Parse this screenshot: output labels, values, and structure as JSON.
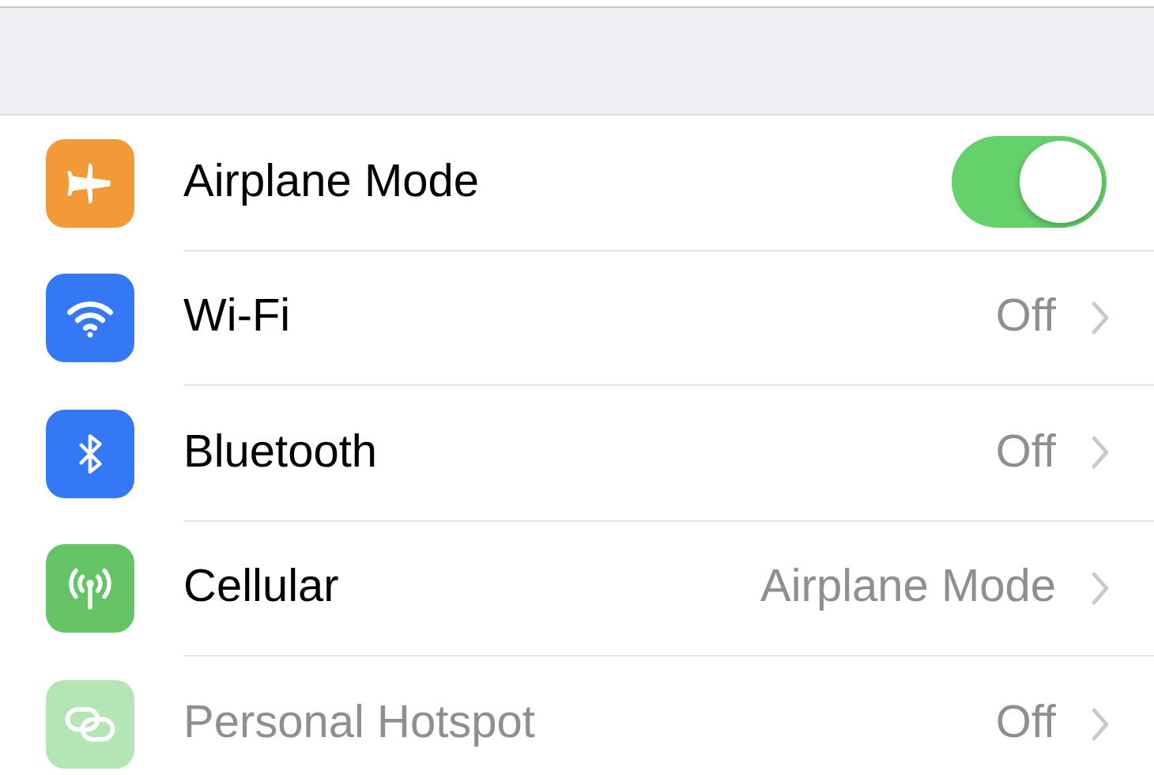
{
  "rows": [
    {
      "kind": "toggle",
      "label": "Airplane Mode",
      "color": "#f19a37",
      "on": true,
      "disabled": false
    },
    {
      "kind": "detail",
      "label": "Wi-Fi",
      "value": "Off",
      "color": "#3478f6",
      "disabled": false
    },
    {
      "kind": "detail",
      "label": "Bluetooth",
      "value": "Off",
      "color": "#3478f6",
      "disabled": false
    },
    {
      "kind": "detail",
      "label": "Cellular",
      "value": "Airplane Mode",
      "color": "#65c466",
      "disabled": false
    },
    {
      "kind": "detail",
      "label": "Personal Hotspot",
      "value": "Off",
      "color": "#b3e6b4",
      "disabled": true
    }
  ]
}
